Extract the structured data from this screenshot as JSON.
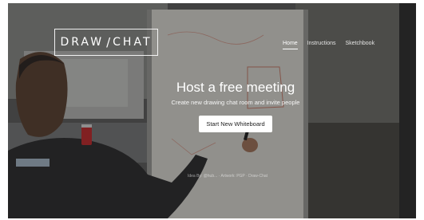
{
  "brand": {
    "name_left": "DRAW",
    "name_right": "CHAT",
    "pen_glyph": "/"
  },
  "nav": {
    "items": [
      {
        "label": "Home",
        "active": true
      },
      {
        "label": "Instructions",
        "active": false
      },
      {
        "label": "Sketchbook",
        "active": false
      }
    ]
  },
  "hero": {
    "title": "Host a free meeting",
    "subtitle": "Create new drawing chat room and invite people",
    "cta_label": "Start New Whiteboard"
  },
  "footer": {
    "links": [
      "Idea By: @hub...",
      "Artwork: PGP",
      "Draw-Chat"
    ],
    "separator": "·"
  },
  "colors": {
    "overlay": "#14141660",
    "cta_bg": "#ffffff",
    "can": "#c4272a"
  }
}
